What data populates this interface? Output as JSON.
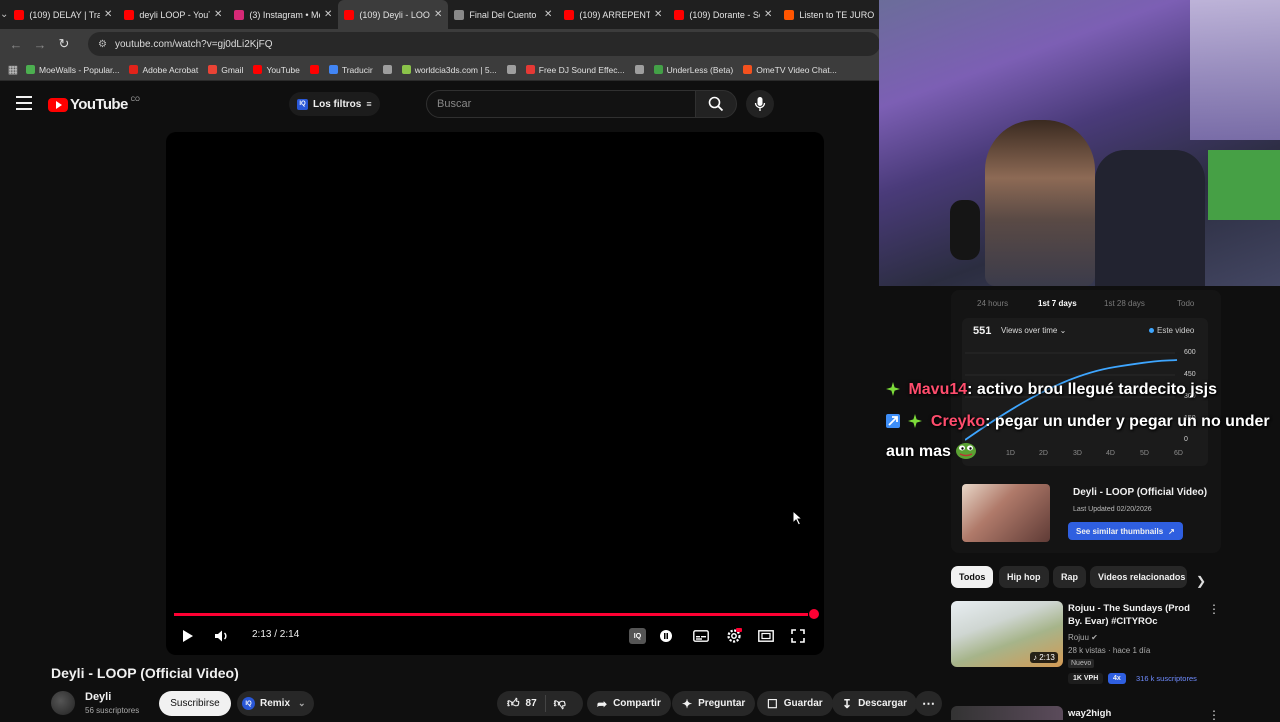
{
  "browser": {
    "tabs": [
      {
        "label": "(109) DELAY | Trap",
        "favicon_color": "#ff0000",
        "active": false
      },
      {
        "label": "deyli LOOP - YouTube",
        "favicon_color": "#ff0000",
        "active": false
      },
      {
        "label": "(3) Instagram • Messages",
        "favicon_color": "#d62976",
        "active": false
      },
      {
        "label": "(109) Deyli - LOOP",
        "favicon_color": "#ff0000",
        "active": true
      },
      {
        "label": "Final Del Cuento",
        "favicon_color": "#888888",
        "active": false
      },
      {
        "label": "(109) ARREPENTIDO",
        "favicon_color": "#ff0000",
        "active": false
      },
      {
        "label": "(109) Dorante - Se",
        "favicon_color": "#ff0000",
        "active": false
      },
      {
        "label": "Listen to TE JURO",
        "favicon_color": "#ff5500",
        "active": false
      }
    ],
    "url": "youtube.com/watch?v=gj0dLi2KjFQ",
    "bookmarks": [
      {
        "label": "MoeWalls - Popular...",
        "icon_color": "#4caf50"
      },
      {
        "label": "Adobe Acrobat",
        "icon_color": "#e2231a"
      },
      {
        "label": "Gmail",
        "icon_color": "#ea4335"
      },
      {
        "label": "YouTube",
        "icon_color": "#ff0000"
      },
      {
        "label": "",
        "icon_color": "#ff0000"
      },
      {
        "label": "Traducir",
        "icon_color": "#4285f4"
      },
      {
        "label": "",
        "icon_color": "#9e9e9e"
      },
      {
        "label": "worldcia3ds.com | 5...",
        "icon_color": "#8bc34a"
      },
      {
        "label": "",
        "icon_color": "#9e9e9e"
      },
      {
        "label": "Free DJ Sound Effec...",
        "icon_color": "#e53935"
      },
      {
        "label": "",
        "icon_color": "#9e9e9e"
      },
      {
        "label": "UnderLess (Beta)",
        "icon_color": "#43a047"
      },
      {
        "label": "OmeTV Video Chat...",
        "icon_color": "#f4511e"
      }
    ]
  },
  "youtube": {
    "logo": "YouTube",
    "country": "CO",
    "filters_label": "Los filtros",
    "search_placeholder": "Buscar",
    "player": {
      "time": "2:13 / 2:14",
      "progress": 0.99
    },
    "video": {
      "title": "Deyli - LOOP (Official Video)",
      "channel": "Deyli",
      "subscribers": "56 suscriptores",
      "subscribe_label": "Suscribirse",
      "remix_label": "Remix",
      "likes": "87",
      "share_label": "Compartir",
      "ask_label": "Preguntar",
      "save_label": "Guardar",
      "download_label": "Descargar"
    }
  },
  "analytics": {
    "ranges": [
      "24 hours",
      "1st 7 days",
      "1st 28 days",
      "Todo"
    ],
    "active_range": "1st 7 days",
    "views": "551",
    "metric_label": "Views over time",
    "legend": "Este video",
    "y_ticks": [
      "600",
      "450",
      "300",
      "150",
      "0"
    ],
    "x_ticks": [
      "1D",
      "2D",
      "3D",
      "4D",
      "5D",
      "6D"
    ],
    "line_color": "#3ea6ff"
  },
  "similar": {
    "title": "Deyli - LOOP (Official Video)",
    "updated": "Last Updated 02/20/2026",
    "button": "See similar thumbnails"
  },
  "chips": [
    "Todos",
    "Hip hop",
    "Rap",
    "Videos relacionados"
  ],
  "recommended": [
    {
      "title": "Rojuu - The Sundays (Prod By. Evar) #CITYROc",
      "channel": "Rojuu",
      "meta": "28 k vistas · hace 1 día",
      "duration": "2:13",
      "new_label": "Nuevo",
      "vph": "1K VPH",
      "multiplier": "4x",
      "subs": "316 k suscriptores"
    },
    {
      "title": "way2high"
    }
  ],
  "chat": [
    {
      "user": "Mavu14",
      "message": ": activo brou llegué tardecito jsjs"
    },
    {
      "user": "Creyko",
      "message": ": pegar un under y pegar un no under",
      "message_cont": "aun mas"
    }
  ],
  "colors": {
    "accent": "#ff0033",
    "brand_blue": "#2f5fe0",
    "chat_name": "#ff4d6d"
  }
}
